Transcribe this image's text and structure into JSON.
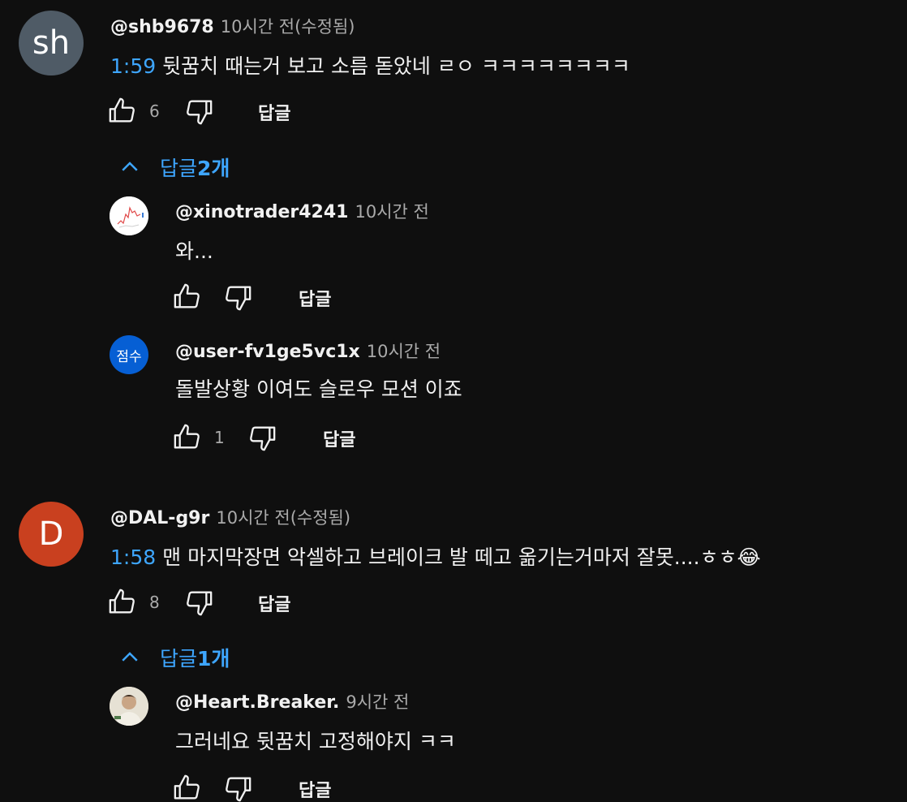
{
  "comments": [
    {
      "avatar": {
        "initials": "sh",
        "color": "#4f5b66"
      },
      "author": "@shb9678",
      "time": "10시간 전(수정됨)",
      "timestamp": "1:59",
      "text": "뒷꿈치 때는거 보고 소름 돋았네 ㄹㅇ ㅋㅋㅋㅋㅋㅋㅋㅋ",
      "likes": "6",
      "reply_label": "답글",
      "replies_toggle": {
        "prefix": "답글 ",
        "count": "2개"
      },
      "replies": [
        {
          "avatar": {
            "type": "chart-thumbnail"
          },
          "author": "@xinotrader4241",
          "time": "10시간 전",
          "text": "와...",
          "likes": "",
          "reply_label": "답글"
        },
        {
          "avatar": {
            "initials": "점수",
            "color": "#065fd4"
          },
          "author": "@user-fv1ge5vc1x",
          "time": "10시간 전",
          "text": "돌발상황 이여도 슬로우 모션 이죠",
          "likes": "1",
          "reply_label": "답글"
        }
      ]
    },
    {
      "avatar": {
        "initials": "D",
        "color": "#c9401f"
      },
      "author": "@DAL-g9r",
      "time": "10시간 전(수정됨)",
      "timestamp": "1:58",
      "text": "맨 마지막장면 악셀하고 브레이크 발 떼고 옮기는거마저 잘못....ㅎㅎ😂",
      "likes": "8",
      "reply_label": "답글",
      "replies_toggle": {
        "prefix": "답글 ",
        "count": "1개"
      },
      "replies": [
        {
          "avatar": {
            "type": "photo"
          },
          "author": "@Heart.Breaker.",
          "time": "9시간 전",
          "text": "그러네요 뒷꿈치 고정해야지 ㅋㅋ",
          "likes": "",
          "reply_label": "답글"
        }
      ]
    }
  ]
}
